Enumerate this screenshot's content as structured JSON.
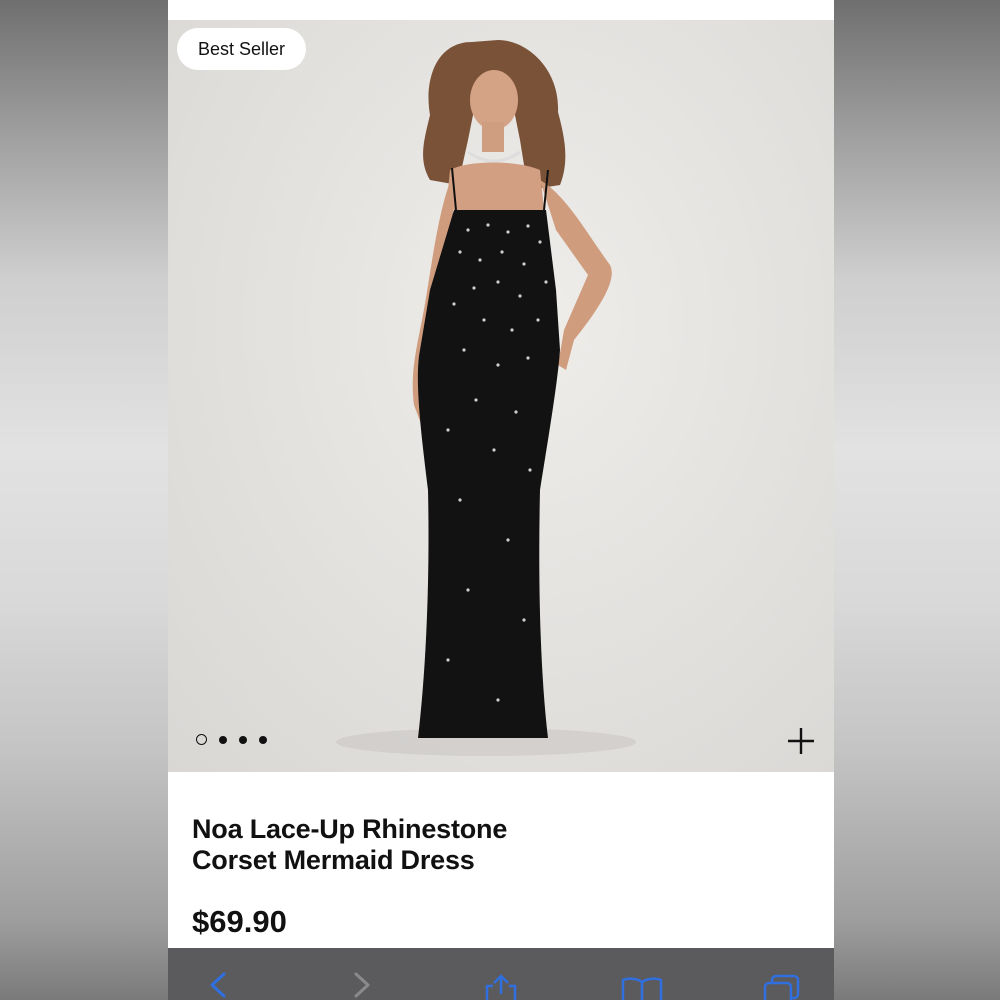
{
  "product": {
    "badge": "Best Seller",
    "title_line1": "Noa Lace-Up Rhinestone",
    "title_line2": "Corset Mermaid Dress",
    "price": "$69.90"
  },
  "gallery": {
    "image_count": 4,
    "active_index": 0
  },
  "toolbar": {
    "icons": [
      "back-icon",
      "forward-icon",
      "share-icon",
      "bookmarks-icon",
      "tabs-icon"
    ]
  },
  "colors": {
    "accent": "#2f6fe0",
    "text": "#111111",
    "toolbar_bg": "#5b5b5d"
  }
}
